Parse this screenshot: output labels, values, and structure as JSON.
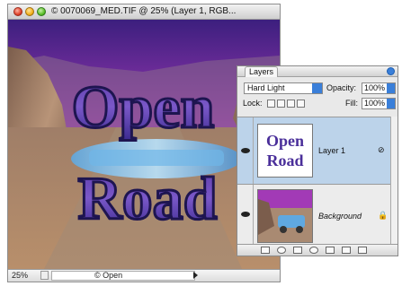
{
  "document_window": {
    "title": "© 0070069_MED.TIF @ 25% (Layer 1, RGB...",
    "status_bar": {
      "zoom": "25%",
      "status_text": "© Open"
    },
    "canvas_text": {
      "line1": "Open",
      "line2": "Road"
    }
  },
  "layers_panel": {
    "tab_label": "Layers",
    "blend_mode": "Hard Light",
    "opacity_label": "Opacity:",
    "opacity_value": "100%",
    "lock_label": "Lock:",
    "fill_label": "Fill:",
    "fill_value": "100%",
    "layers": [
      {
        "name": "Layer 1",
        "thumb_line1": "Open",
        "thumb_line2": "Road",
        "selected": true
      },
      {
        "name": "Background",
        "selected": false
      }
    ]
  },
  "colors": {
    "selection": "#bcd3ea",
    "accent_blue": "#3a7fd9",
    "text_purple": "#4a2f9a"
  }
}
